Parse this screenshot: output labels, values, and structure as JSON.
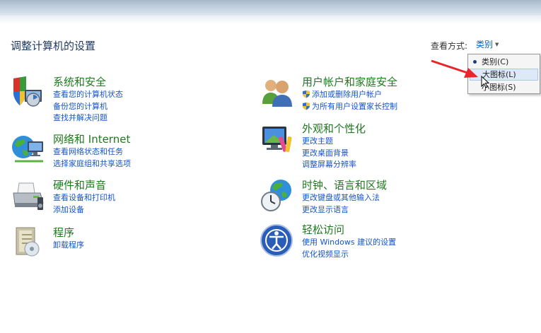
{
  "page": {
    "title": "调整计算机的设置",
    "view_by_label": "查看方式:",
    "view_by_value": "类别"
  },
  "dropdown": {
    "items": [
      "类别(C)",
      "大图标(L)",
      "小图标(S)"
    ],
    "selected_index": 0,
    "highlighted_index": 1
  },
  "categories": [
    {
      "title": "系统和安全",
      "icon": "shield-computer-icon",
      "links": [
        "查看您的计算机状态",
        "备份您的计算机",
        "查找并解决问题"
      ]
    },
    {
      "title": "网络和 Internet",
      "icon": "network-globe-icon",
      "links": [
        "查看网络状态和任务",
        "选择家庭组和共享选项"
      ]
    },
    {
      "title": "硬件和声音",
      "icon": "printer-icon",
      "links": [
        "查看设备和打印机",
        "添加设备"
      ]
    },
    {
      "title": "程序",
      "icon": "programs-icon",
      "links": [
        "卸载程序"
      ]
    },
    {
      "title": "用户帐户和家庭安全",
      "icon": "users-icon",
      "links": [
        "添加或删除用户帐户",
        "为所有用户设置家长控制"
      ]
    },
    {
      "title": "外观和个性化",
      "icon": "monitor-paint-icon",
      "links": [
        "更改主题",
        "更改桌面背景",
        "调整屏幕分辨率"
      ]
    },
    {
      "title": "时钟、语言和区域",
      "icon": "clock-globe-icon",
      "links": [
        "更改键盘或其他输入法",
        "更改显示语言"
      ]
    },
    {
      "title": "轻松访问",
      "icon": "ease-of-access-icon",
      "links": [
        "使用 Windows 建议的设置",
        "优化视频显示"
      ]
    }
  ],
  "colors": {
    "category_title": "#1e7a1e",
    "link": "#1655c7",
    "annotation_arrow": "#e8272a"
  }
}
